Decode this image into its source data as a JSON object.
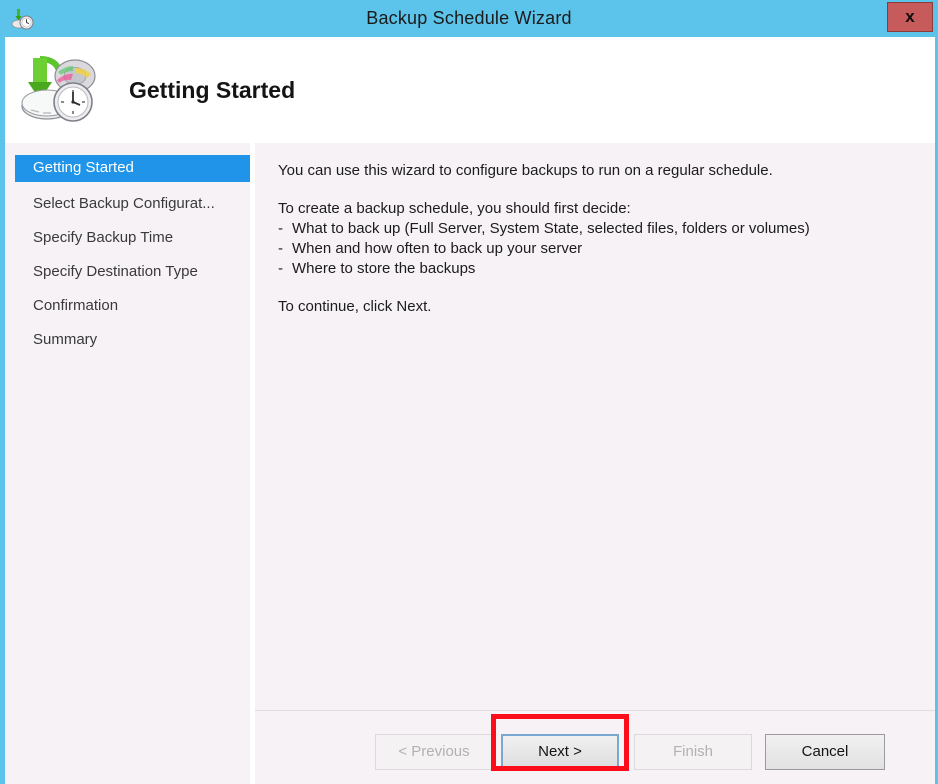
{
  "window": {
    "title": "Backup Schedule Wizard",
    "title_icon": "backup-clock-icon",
    "close_label": "x",
    "accent_titlebar_color": "#5cc3ea",
    "close_button_color": "#c75b5b",
    "body_background_color": "#f7f2f6"
  },
  "header": {
    "icon": "backup-schedule-clock-icon",
    "title": "Getting Started"
  },
  "sidebar": {
    "selected_index": 0,
    "selected_color": "#1f94e8",
    "items": [
      {
        "label": "Getting Started"
      },
      {
        "label": "Select Backup Configurat..."
      },
      {
        "label": "Specify Backup Time"
      },
      {
        "label": "Specify Destination Type"
      },
      {
        "label": "Confirmation"
      },
      {
        "label": "Summary"
      }
    ]
  },
  "content": {
    "intro": "You can use this wizard to configure backups to run on a regular schedule.",
    "decide_heading": "To create a backup schedule, you should first decide:",
    "bullets": [
      "What to back up (Full Server, System State, selected files, folders or volumes)",
      "When and how often to back up your server",
      "Where to store the backups"
    ],
    "bullet_marker": "-",
    "continue_text": "To continue, click Next."
  },
  "footer": {
    "buttons": [
      {
        "label": "< Previous",
        "state": "disabled"
      },
      {
        "label": "Next >",
        "state": "focused"
      },
      {
        "label": "Finish",
        "state": "disabled"
      },
      {
        "label": "Cancel",
        "state": "enabled"
      }
    ]
  },
  "annotation": {
    "highlight_target": "Next >",
    "highlight_color": "#fb0d1b"
  }
}
